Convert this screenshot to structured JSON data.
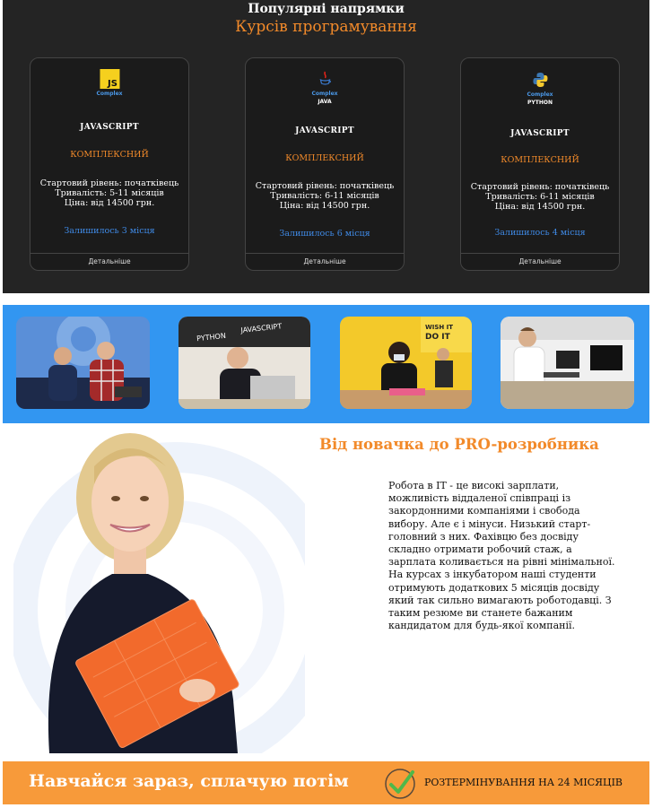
{
  "courses": {
    "title": "Популярні напрямки",
    "subtitle": "Курсів програмування",
    "cards": [
      {
        "logo_type": "js-logo",
        "logo_text": "JS",
        "logo_caption": "Complex",
        "logo_sub": "",
        "name": "JAVASCRIPT",
        "level": "КОМПЛЕКСНИЙ",
        "start": "Стартовий рівень: початківець",
        "duration": "Тривалість: 5-11 місяців",
        "price": "Ціна: від 14500 грн.",
        "remaining": "Залишилось 3 місця",
        "more": "Детальніше"
      },
      {
        "logo_type": "java-logo",
        "logo_text": "",
        "logo_caption": "Complex",
        "logo_sub": "JAVA",
        "name": "JAVASCRIPT",
        "level": "КОМПЛЕКСНИЙ",
        "start": "Стартовий рівень: початківець",
        "duration": "Тривалість: 6-11 місяців",
        "price": "Ціна: від 14500 грн.",
        "remaining": "Залишилось 6 місця",
        "more": "Детальніше"
      },
      {
        "logo_type": "python-logo",
        "logo_text": "",
        "logo_caption": "Complex",
        "logo_sub": "PYTHON",
        "name": "JAVASCRIPT",
        "level": "КОМПЛЕКСНИЙ",
        "start": "Стартовий рівень: початківець",
        "duration": "Тривалість: 6-11 місяців",
        "price": "Ціна: від 14500 грн.",
        "remaining": "Залишилось 4 місця",
        "more": "Детальніше"
      }
    ]
  },
  "photos": {
    "items": [
      "classroom-photo",
      "student-at-laptop-photo",
      "student-in-mask-photo",
      "student-at-computer-photo"
    ],
    "wall_texts": [
      "WISH IT",
      "DO IT",
      "PYTHON",
      "JAVASCRIPT"
    ]
  },
  "hero": {
    "title": "Від новачка до PRO-розробника",
    "paragraph": "Робота в IT - це високі зарплати, можливість віддаленої співпраці із закордонними компаніями і свобода вибору. Але є і мінуси. Низький старт-головний з них. Фахівцю без досвіду складно отримати робочий стаж, а зарплата коливається на рівні мінімальної. На курсах з інкубатором наші студенти отримують додаткових 5 місяців досвіду який так сильно вимагають роботодавці. З таким резюме ви станете бажаним кандидатом для будь-якої компанії."
  },
  "banner": {
    "cta": "Навчайся зараз, сплачую потім",
    "badge": "РОЗТЕРМІНУВАННЯ НА 24 МІСЯЦІВ",
    "badge_icon": "check-icon"
  },
  "colors": {
    "dark_bg": "#242424",
    "accent_orange": "#f28a2a",
    "link_blue": "#3f8ae6",
    "strip_blue": "#3296f1",
    "banner_orange": "#f79a3a",
    "check_green": "#4fb84a"
  }
}
